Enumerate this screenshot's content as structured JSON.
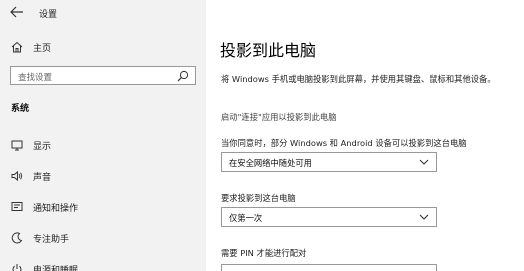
{
  "window": {
    "title": "设置"
  },
  "nav": {
    "home_label": "主页",
    "search_placeholder": "查找设置",
    "section": "系统",
    "items": [
      {
        "label": "显示",
        "icon": "display-icon"
      },
      {
        "label": "声音",
        "icon": "sound-icon"
      },
      {
        "label": "通知和操作",
        "icon": "notification-icon"
      },
      {
        "label": "专注助手",
        "icon": "focus-assist-icon"
      },
      {
        "label": "电源和睡眠",
        "icon": "power-icon"
      }
    ]
  },
  "main": {
    "title": "投影到此电脑",
    "description": "将 Windows 手机或电脑投影到此屏幕，并使用其键盘、鼠标和其他设备。",
    "launch_link": "启动\"连接\"应用以投影到此电脑",
    "fields": [
      {
        "label": "当你同意时，部分 Windows 和 Android 设备可以投影到这台电脑",
        "value": "在安全网络中随处可用"
      },
      {
        "label": "要求投影到这台电脑",
        "value": "仅第一次"
      },
      {
        "label": "需要 PIN 才能进行配对"
      }
    ]
  },
  "colors": {
    "sidebar_bg": "#f2f2f2",
    "content_bg": "#ffffff",
    "border": "#999999"
  }
}
